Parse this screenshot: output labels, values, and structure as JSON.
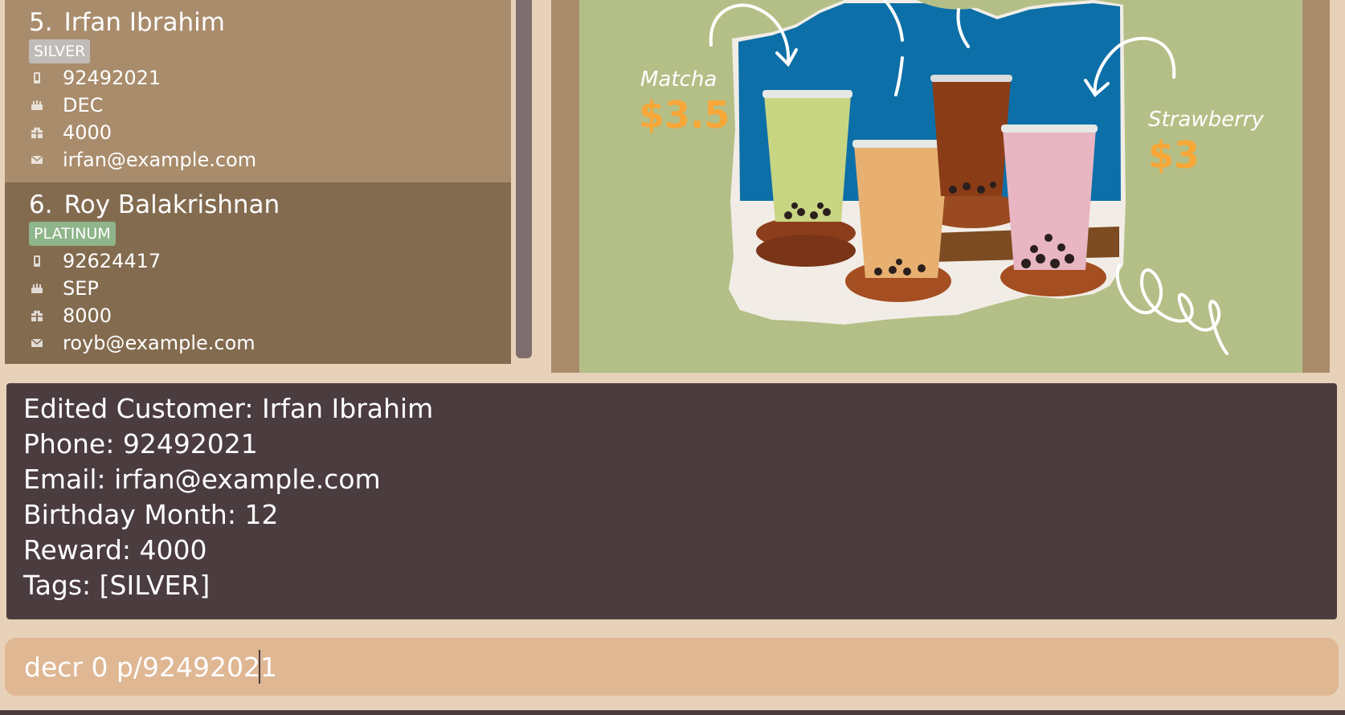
{
  "customers": [
    {
      "index": "5.",
      "name": "Irfan Ibrahim",
      "tag": "SILVER",
      "phone": "92492021",
      "birthday_month": "DEC",
      "reward": "4000",
      "email": "irfan@example.com"
    },
    {
      "index": "6.",
      "name": "Roy Balakrishnan",
      "tag": "PLATINUM",
      "phone": "92624417",
      "birthday_month": "SEP",
      "reward": "8000",
      "email": "royb@example.com"
    }
  ],
  "icons": {
    "phone": "phone-icon",
    "birthday": "cake-icon",
    "reward": "gift-icon",
    "email": "envelope-icon"
  },
  "promo": {
    "matcha_label": "Matcha",
    "matcha_price": "$3.5",
    "strawberry_label": "Strawberry",
    "strawberry_price": "$3"
  },
  "result": {
    "lines": [
      "Edited Customer: Irfan Ibrahim",
      "Phone: 92492021",
      "Email: irfan@example.com",
      "Birthday Month: 12",
      "Reward: 4000",
      "Tags: [SILVER]"
    ]
  },
  "command": {
    "value": "decr 0 p/92492021"
  },
  "colors": {
    "card_odd": "#a98c6c",
    "card_even": "#836b50",
    "result_bg": "#4b3c3f",
    "command_bg": "#dfb793",
    "price": "#f7a738",
    "tag_silver": "#c0bcb8",
    "tag_platinum": "#8fb58a"
  }
}
